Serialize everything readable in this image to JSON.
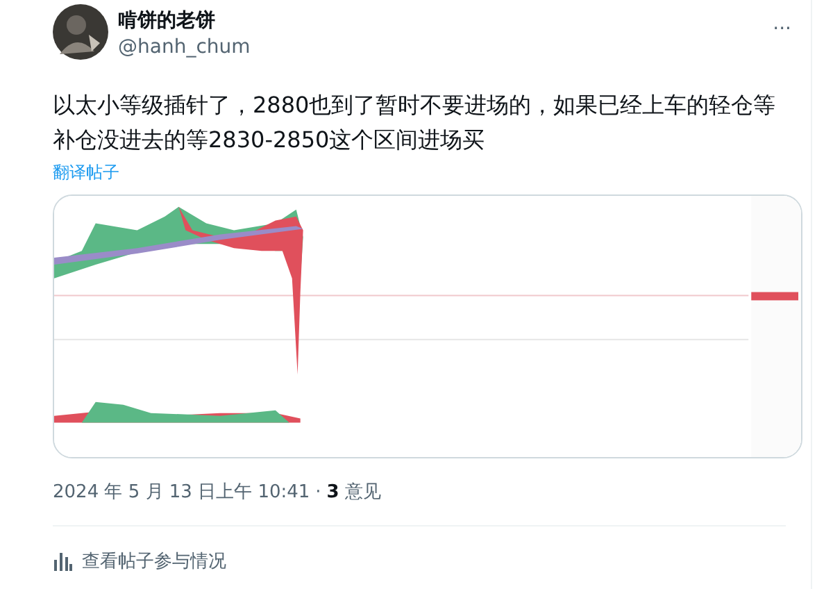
{
  "author": {
    "name": "啃饼的老饼",
    "handle": "@hanh_chum"
  },
  "more": "···",
  "text": "以太小等级插针了，2880也到了暂时不要进场的，如果已经上车的轻仓等补仓没进去的等2830-2850这个区间进场买",
  "translate": "翻译帖子",
  "meta": {
    "time": "2024 年 5 月 13 日上午 10:41",
    "separator": "·",
    "count": "3",
    "count_label": "意见"
  },
  "engagement": "查看帖子参与情况"
}
